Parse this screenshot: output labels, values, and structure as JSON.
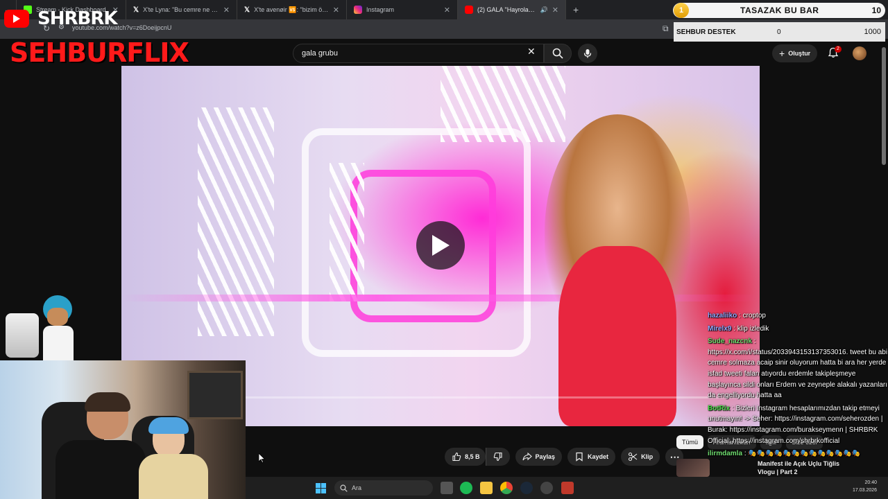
{
  "browser": {
    "tabs": [
      {
        "label": "Stream - Kick Dashboard",
        "fav_color": "#53fc18"
      },
      {
        "label": "X'te Lyna: \"Bu cemre ne yasiyo",
        "fav_color": "#ffffff"
      },
      {
        "label": "X'te avenøir 🆚: \"bizim öngörü",
        "fav_color": "#ffffff"
      },
      {
        "label": "Instagram",
        "fav_color": "#e1306c"
      },
      {
        "label": "(2) GALA \"Hayrola Aşkım\" ||",
        "fav_color": "#ff0000"
      }
    ],
    "url": "youtube.com/watch?v=z6DoeijpcnU"
  },
  "youtube": {
    "search_value": "gala grubu",
    "create_label": "Oluştur",
    "notification_count": "2",
    "actions": {
      "like": "8,5 B",
      "share": "Paylaş",
      "save": "Kaydet",
      "clip": "Klip"
    },
    "chips": [
      "Tümü",
      "Aramanızdan",
      "İlgili",
      "Size özel"
    ],
    "recommendations": [
      "Manifest ile Açık Uçlu Tiğlis",
      "Vlogu | Part 2"
    ],
    "colors": {
      "accent": "#ff0000",
      "bg": "#0f0f0f",
      "pill": "#272727"
    }
  },
  "overlay": {
    "channel_logo": "SHRBRK",
    "brand": "SEHBURFLIX",
    "bar_widget": {
      "rank": "1",
      "title": "TASAZAK BU BAR",
      "count": "10"
    },
    "destek": {
      "label": "SEHBUR DESTEK",
      "current": "0",
      "goal": "1000"
    }
  },
  "chat": {
    "messages": [
      {
        "user": "hazaliiko",
        "color": "#8fa8ff",
        "text": ": croptop"
      },
      {
        "user": "Mirelx9",
        "color": "#8fa8ff",
        "text": ": klip izledik"
      },
      {
        "user": "Sude_nazcnk",
        "color": "#6fdc6f",
        "text": ": https://x.com/i/status/2033943153137353016. tweet bu abi cemre solmaza acaip sinir oluyorum hatta bi ara her yerde isfad tweeti falan atıyordu erdemle takipleşmeye başlayınca sildi onları Erdem ve zeyneple alakalı yazanları da engelliyordu hatta aa"
      },
      {
        "user": "BotRix",
        "color": "#4be04b",
        "text": ": Bizleri Instagram hesaplarımızdan takip etmeyi unutmayın! -> Seher: https://instagram.com/seherozden | Burak: https://instagram.com/burakseymenn | SHRBRK Official: https://instagram.com/shrbrkofficial"
      },
      {
        "user": "ilirmdamla",
        "color": "#6fdc6f",
        "text": ": 🎭🎭🎭🎭🎭🎭🎭🎭🎭🎭🎭🎭🎭"
      }
    ]
  },
  "taskbar": {
    "search_placeholder": "Ara",
    "time": "20:40",
    "date": "17.03.2026"
  }
}
